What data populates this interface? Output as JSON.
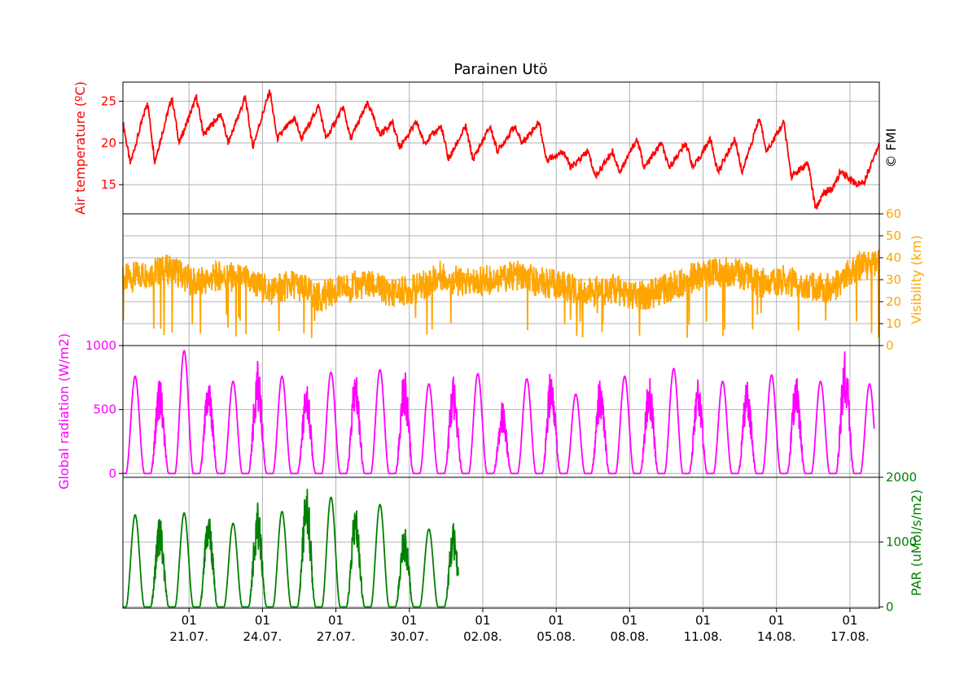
{
  "title": "Parainen Utö",
  "copyright": "© FMI",
  "colors": {
    "temperature": "#ff0000",
    "visibility": "#ffa500",
    "radiation": "#ff00ff",
    "par": "#008000",
    "grid": "#b0b0b0",
    "axis": "#000000"
  },
  "x_axis": {
    "tick_top_labels": [
      "01",
      "01",
      "01",
      "01",
      "01",
      "01",
      "01",
      "01",
      "01",
      "01"
    ],
    "tick_bottom_labels": [
      "21.07.",
      "24.07.",
      "27.07.",
      "30.07.",
      "02.08.",
      "05.08.",
      "08.08.",
      "11.08.",
      "14.08.",
      "17.08."
    ]
  },
  "chart_data": [
    {
      "type": "line",
      "name": "temperature",
      "ylabel": "Air temperature (ºC)",
      "ylim": [
        11.5,
        27.3
      ],
      "yticks": [
        15,
        20,
        25
      ],
      "ytick_labels": [
        "15",
        "20",
        "25"
      ],
      "label_side": "left",
      "grid": true,
      "x_range_days": [
        "18.07.",
        "18.08."
      ],
      "series": [
        {
          "x": [
            0,
            0.3,
            1.0,
            1.3,
            2.0,
            2.3,
            3.0,
            3.3,
            4.0,
            4.3,
            5.0,
            5.3,
            6.0,
            6.3,
            7.0,
            7.3,
            8.0,
            8.3,
            9.0,
            9.3,
            10.0,
            10.5,
            11.0,
            11.3,
            12.0,
            12.3,
            13.0,
            13.3,
            14.0,
            14.3,
            15.0,
            15.3,
            16.0,
            16.3,
            17.0,
            17.3,
            18.0,
            18.3,
            19.0,
            19.3,
            20.0,
            20.3,
            21.0,
            21.3,
            22.0,
            22.3,
            23.0,
            23.3,
            24.0,
            24.3,
            25.0,
            25.3,
            26.0,
            26.3,
            27.0,
            27.3,
            28.0,
            28.3,
            28.6,
            29.0,
            29.3,
            29.8,
            30.0,
            30.3,
            30.9
          ],
          "values": [
            22.5,
            17.5,
            25.0,
            17.8,
            25.5,
            20.0,
            25.5,
            21.0,
            23.5,
            20.0,
            25.5,
            19.5,
            26.3,
            20.5,
            23.0,
            20.5,
            24.5,
            20.5,
            24.3,
            20.5,
            24.8,
            21.0,
            22.5,
            19.5,
            22.5,
            20.0,
            22.0,
            18.0,
            22.0,
            18.0,
            22.0,
            19.0,
            22.0,
            20.0,
            22.5,
            18.0,
            19.0,
            17.0,
            19.0,
            16.0,
            19.0,
            16.5,
            20.5,
            17.0,
            20.0,
            17.0,
            20.0,
            17.0,
            20.5,
            16.5,
            20.5,
            16.5,
            23.0,
            19.0,
            22.5,
            16.0,
            17.5,
            12.0,
            14.0,
            14.5,
            16.5,
            15.5,
            15.0,
            15.5,
            20.0
          ]
        }
      ]
    },
    {
      "type": "line",
      "name": "visibility",
      "ylabel": "Visibility (km)",
      "ylim": [
        0,
        60
      ],
      "yticks": [
        0,
        10,
        20,
        30,
        40,
        50,
        60
      ],
      "ytick_labels": [
        "0",
        "10",
        "20",
        "30",
        "40",
        "50",
        "60"
      ],
      "label_side": "right",
      "grid": true,
      "series": [
        {
          "x": [
            0,
            1,
            2,
            3,
            4,
            5,
            6,
            7,
            8,
            9,
            10,
            11,
            12,
            13,
            14,
            15,
            16,
            17,
            18,
            19,
            20,
            21,
            22,
            23,
            24,
            25,
            26,
            27,
            28,
            29,
            30,
            30.9
          ],
          "values": [
            30,
            33,
            35,
            28,
            32,
            30,
            25,
            28,
            22,
            26,
            28,
            24,
            26,
            32,
            28,
            30,
            32,
            29,
            27,
            24,
            26,
            22,
            25,
            30,
            33,
            34,
            28,
            30,
            27,
            26,
            36,
            38
          ]
        }
      ]
    },
    {
      "type": "line",
      "name": "radiation",
      "ylabel": "Global radiation (W/m2)",
      "ylim": [
        -30,
        1000
      ],
      "yticks": [
        0,
        500,
        1000
      ],
      "ytick_labels": [
        "0",
        "500",
        "1000"
      ],
      "label_side": "left",
      "grid": true,
      "series": [
        {
          "x": [
            0,
            1,
            2,
            3,
            4,
            5,
            6,
            7,
            8,
            9,
            10,
            11,
            12,
            13,
            14,
            15,
            16,
            17,
            18,
            19,
            20,
            21,
            22,
            23,
            24,
            25,
            26,
            27,
            28,
            29,
            30
          ],
          "values": [
            760,
            760,
            960,
            760,
            720,
            880,
            760,
            720,
            790,
            810,
            810,
            820,
            700,
            760,
            780,
            560,
            740,
            830,
            620,
            760,
            760,
            780,
            820,
            760,
            720,
            760,
            770,
            780,
            720,
            960,
            700
          ]
        }
      ]
    },
    {
      "type": "line",
      "name": "par",
      "ylabel": "PAR (uMol/s/m2)",
      "ylim": [
        -20,
        2000
      ],
      "yticks": [
        0,
        1000,
        2000
      ],
      "ytick_labels": [
        "0",
        "1000",
        "2000"
      ],
      "label_side": "right",
      "grid": true,
      "series": [
        {
          "x": [
            0,
            1,
            2,
            3,
            4,
            5,
            6,
            7,
            8,
            9,
            10,
            11,
            12,
            13
          ],
          "values": [
            1420,
            1420,
            1450,
            1500,
            1290,
            1610,
            1470,
            1920,
            1690,
            1600,
            1580,
            1250,
            1200,
            1300
          ]
        }
      ]
    }
  ]
}
